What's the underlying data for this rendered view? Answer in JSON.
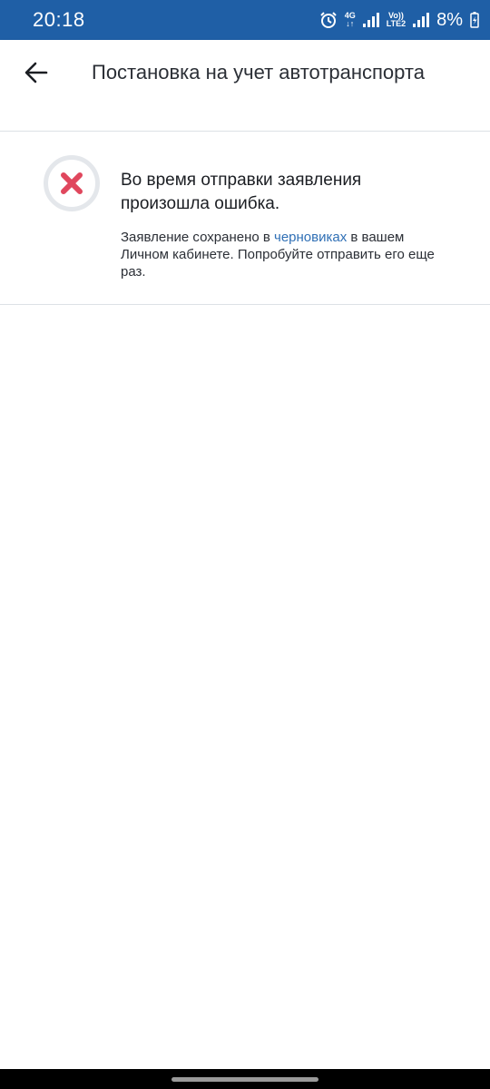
{
  "status_bar": {
    "time": "20:18",
    "network_4g": "4G",
    "volte_top": "Vo))",
    "volte_bottom": "LTE2",
    "battery": "8%",
    "icons": [
      "alarm-icon",
      "data-arrows-icon",
      "signal-icon",
      "signal-icon",
      "battery-charging-icon"
    ]
  },
  "app_bar": {
    "back_icon": "arrow-left-icon",
    "title": "Постановка на учет автотранспорта"
  },
  "error": {
    "icon": "error-x-icon",
    "title": "Во время отправки заявления произошла ошибка.",
    "desc_before": "Заявление сохранено в ",
    "desc_link": "черновиках",
    "desc_after": " в вашем Личном кабинете. Попробуйте отправить его еще раз.",
    "colors": {
      "x": "#e0475d",
      "ring": "#e4e7eb",
      "link": "#2f6fb5"
    }
  },
  "colors": {
    "status_bar": "#1f5fa6",
    "nav_bar": "#000000"
  }
}
